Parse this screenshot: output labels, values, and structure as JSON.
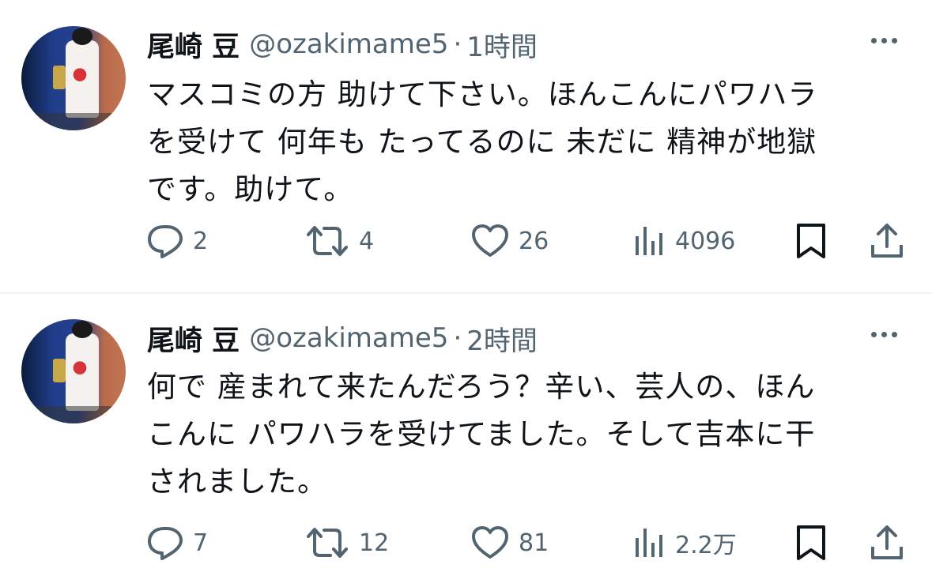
{
  "tweets": [
    {
      "name": "尾崎 豆",
      "handle": "@ozakimame5",
      "separator": "·",
      "time": "1時間",
      "lines": [
        "マスコミの方 助けて下さい。ほんこんにパワハラ",
        "を受けて 何年も たってるのに 未だに 精神が地獄",
        "です。助けて。"
      ],
      "reply_count": "2",
      "retweet_count": "4",
      "like_count": "26",
      "view_count": "4096"
    },
    {
      "name": "尾崎 豆",
      "handle": "@ozakimame5",
      "separator": "·",
      "time": "2時間",
      "lines": [
        "何で 産まれて来たんだろう？辛い、芸人の、ほん",
        "こんに パワハラを受けてました。そして吉本に干",
        "されました。"
      ],
      "reply_count": "7",
      "retweet_count": "12",
      "like_count": "81",
      "view_count": "2.2万"
    }
  ],
  "icons": {
    "reply": "speech-bubble",
    "retweet": "retweet-arrows",
    "like": "heart",
    "views": "bar-chart",
    "bookmark": "bookmark",
    "share": "upload-arrow",
    "more": "three-dots"
  },
  "colors": {
    "text": "#0f1419",
    "secondary": "#536471",
    "divider": "#eff3f4"
  }
}
